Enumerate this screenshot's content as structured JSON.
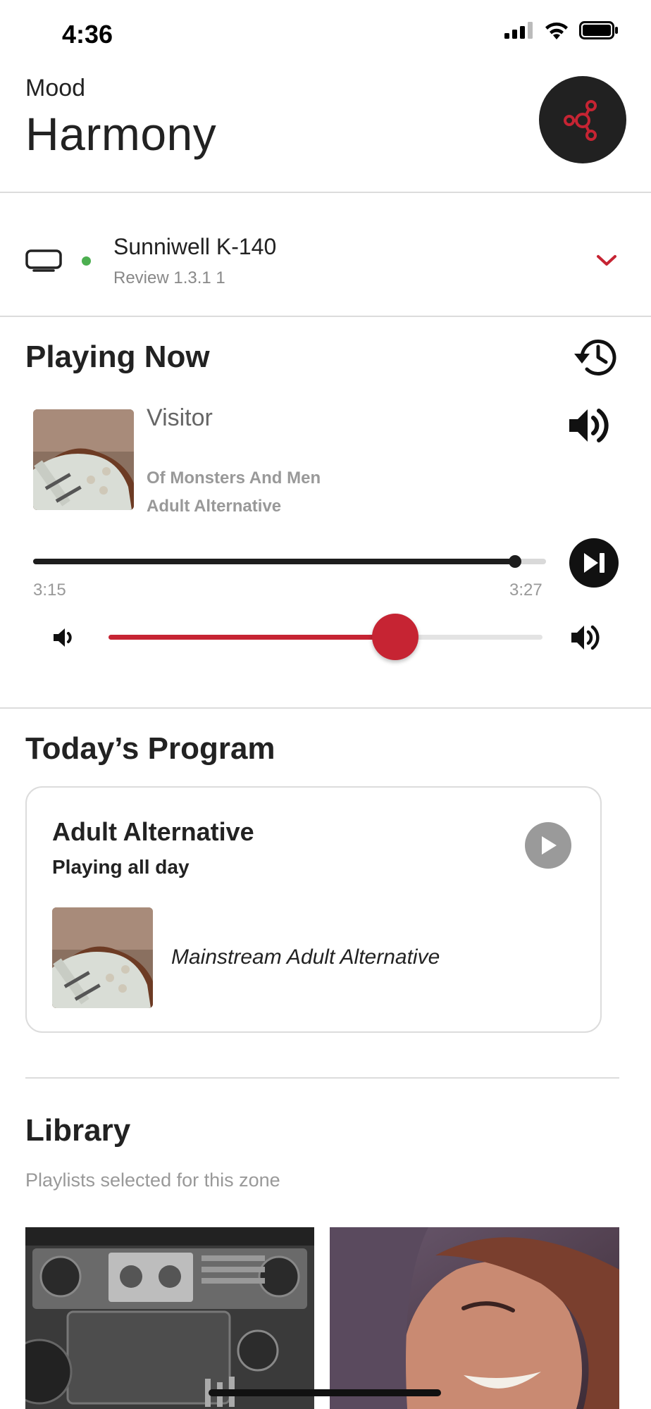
{
  "status_bar": {
    "time": "4:36",
    "icons": [
      "signal-icon",
      "wifi-icon",
      "battery-icon"
    ]
  },
  "header": {
    "label": "Mood",
    "title": "Harmony",
    "action_icon": "hub-icon"
  },
  "device": {
    "name": "Sunniwell K-140",
    "subtitle": "Review 1.3.1 1",
    "status": "online",
    "status_color": "#4caf50"
  },
  "playing_now": {
    "title": "Playing Now",
    "track": "Visitor",
    "artist": "Of Monsters And Men",
    "genre": "Adult Alternative",
    "elapsed": "3:15",
    "total": "3:27",
    "progress": 0.94,
    "volume": 0.66
  },
  "program": {
    "section_title": "Today’s Program",
    "name": "Adult Alternative",
    "schedule": "Playing all day",
    "playlist": "Mainstream Adult Alternative"
  },
  "library": {
    "title": "Library",
    "subtitle": "Playlists selected for this zone"
  },
  "colors": {
    "accent": "#c62433",
    "dark": "#212121",
    "muted": "#999999"
  }
}
